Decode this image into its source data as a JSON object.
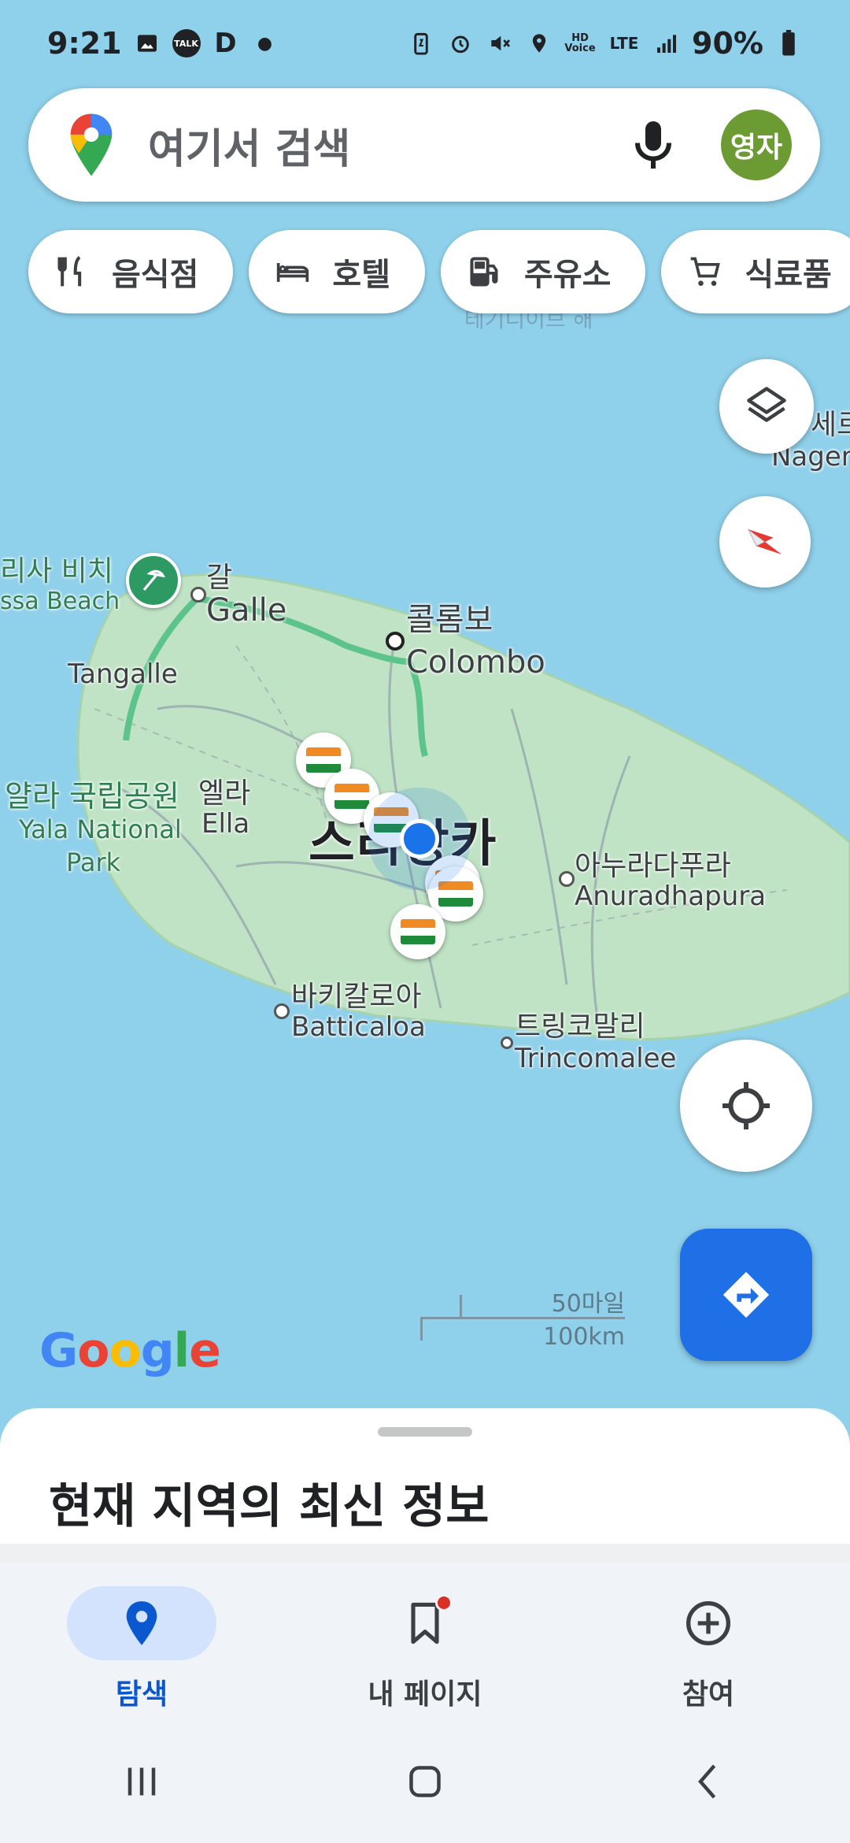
{
  "status_bar": {
    "time": "9:21",
    "left_icons": [
      "gallery-icon",
      "talk-icon",
      "d-icon",
      "dot-icon"
    ],
    "talk_text": "TALK",
    "d_text": "D",
    "right_icons": [
      "battery-saver-icon",
      "alarm-icon",
      "mute-icon",
      "location-icon",
      "hd-voice-icon",
      "lte-icon",
      "signal-icon",
      "battery-icon"
    ],
    "hd_text": "HD",
    "voice_text": "Voice",
    "lte_text": "LTE",
    "battery": "90%"
  },
  "search": {
    "placeholder": "여기서 검색",
    "avatar_text": "영자",
    "avatar_color": "#6c9b34"
  },
  "chips": [
    {
      "label": "음식점",
      "icon": "restaurant-icon"
    },
    {
      "label": "호텔",
      "icon": "hotel-icon"
    },
    {
      "label": "주유소",
      "icon": "gas-station-icon"
    },
    {
      "label": "식료품",
      "icon": "grocery-icon"
    }
  ],
  "map": {
    "faint_top_label": "테기디이브 해",
    "right_edge_ko": "세르",
    "right_edge_en": "Nager",
    "beach_ko": "리사 비치",
    "beach_en": "ssa Beach",
    "galle_ko": "갈",
    "galle_en": "Galle",
    "colombo_ko": "콜롬보",
    "colombo_en": "Colombo",
    "tangalle": "Tangalle",
    "yala_ko": "얄라 국립공원",
    "yala_en1": "Yala National",
    "yala_en2": "Park",
    "ella_ko": "엘라",
    "ella_en": "Ella",
    "country": "스리랑카",
    "anuradhapura_ko": "아누라다푸라",
    "anuradhapura_en": "Anuradhapura",
    "batticaloa_ko": "바키칼로아",
    "batticaloa_en": "Batticaloa",
    "trinco_ko": "트링코말리",
    "trinco_en": "Trincomalee",
    "scale_miles": "50마일",
    "scale_km": "100km",
    "google_logo": "Google",
    "water_color": "#8fd0ea",
    "land_color": "#bfe3c4",
    "route_color": "#5cc38a"
  },
  "sheet": {
    "title": "현재 지역의 최신 정보"
  },
  "bottom_nav": [
    {
      "label": "탐색",
      "icon": "explore-pin-icon",
      "active": true
    },
    {
      "label": "내 페이지",
      "icon": "bookmark-icon",
      "active": false
    },
    {
      "label": "참여",
      "icon": "add-circle-icon",
      "active": false
    }
  ],
  "system_nav": [
    "recents-icon",
    "home-icon",
    "back-icon"
  ]
}
